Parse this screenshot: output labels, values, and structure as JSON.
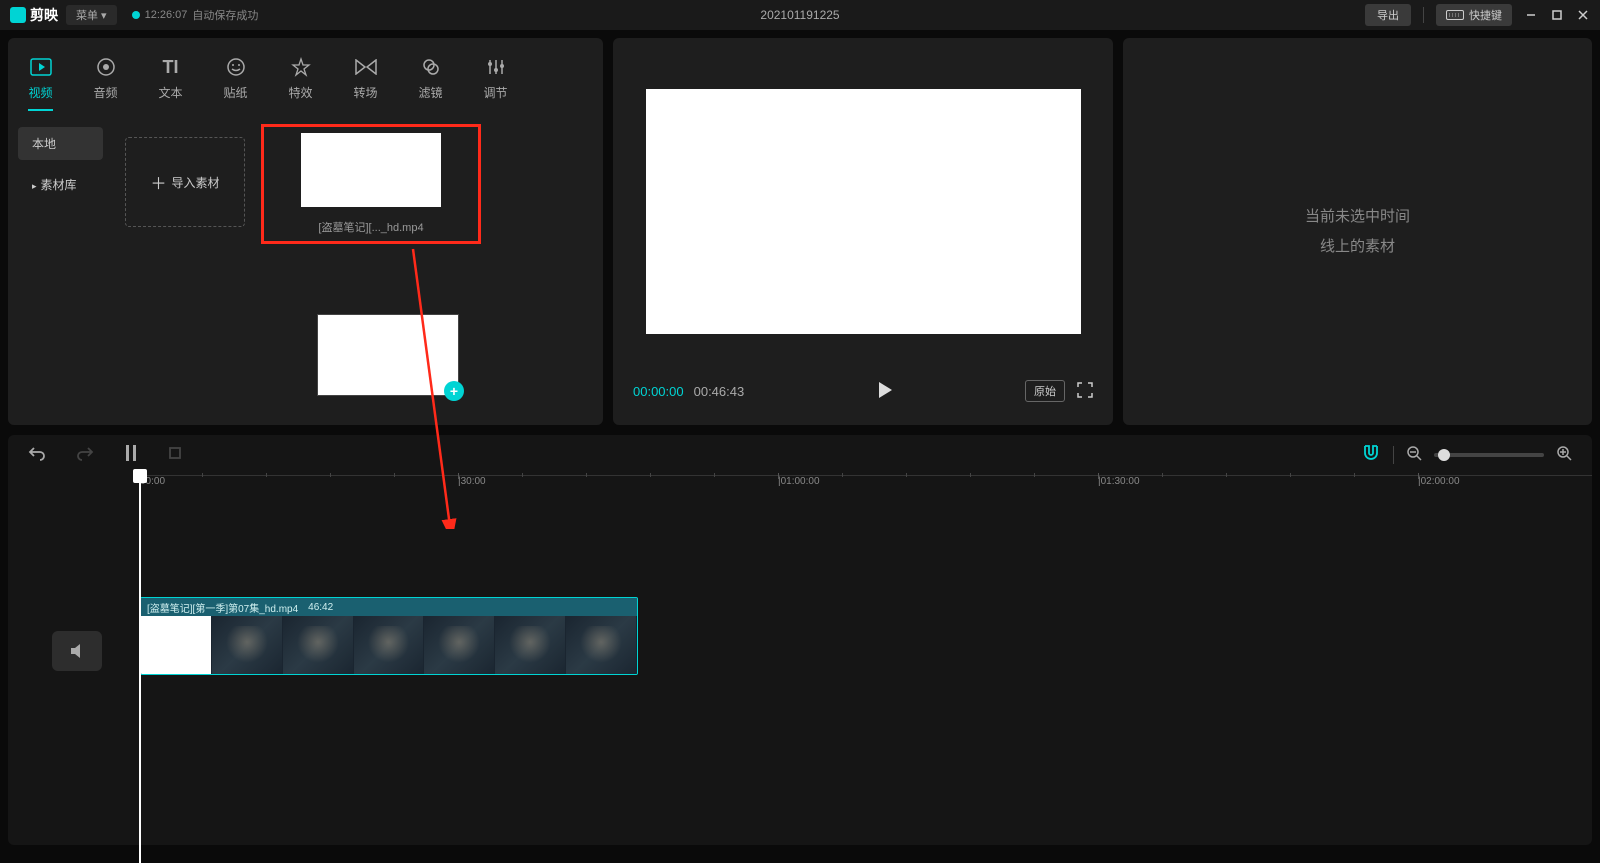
{
  "titlebar": {
    "app_name": "剪映",
    "menu_label": "菜单 ▾",
    "save_time": "12:26:07",
    "save_text": "自动保存成功",
    "project_name": "202101191225",
    "export_label": "导出",
    "shortcut_label": "快捷键"
  },
  "media_tabs": [
    {
      "label": "视频",
      "icon": "video"
    },
    {
      "label": "音频",
      "icon": "audio"
    },
    {
      "label": "文本",
      "icon": "text"
    },
    {
      "label": "贴纸",
      "icon": "sticker"
    },
    {
      "label": "特效",
      "icon": "effect"
    },
    {
      "label": "转场",
      "icon": "transition"
    },
    {
      "label": "滤镜",
      "icon": "filter"
    },
    {
      "label": "调节",
      "icon": "adjust"
    }
  ],
  "media_side": {
    "local": "本地",
    "library": "素材库"
  },
  "import_label": "导入素材",
  "clip_name": "[盗墓笔记][..._hd.mp4",
  "preview": {
    "current": "00:00:00",
    "duration": "00:46:43",
    "ratio_label": "原始"
  },
  "inspect_empty_l1": "当前未选中时间",
  "inspect_empty_l2": "线上的素材",
  "timeline": {
    "ticks": [
      "00:00",
      "|30:00",
      "|01:00:00",
      "|01:30:00",
      "|02:00:00"
    ],
    "clip_title": "[盗墓笔记][第一季]第07集_hd.mp4",
    "clip_dur": "46:42"
  }
}
